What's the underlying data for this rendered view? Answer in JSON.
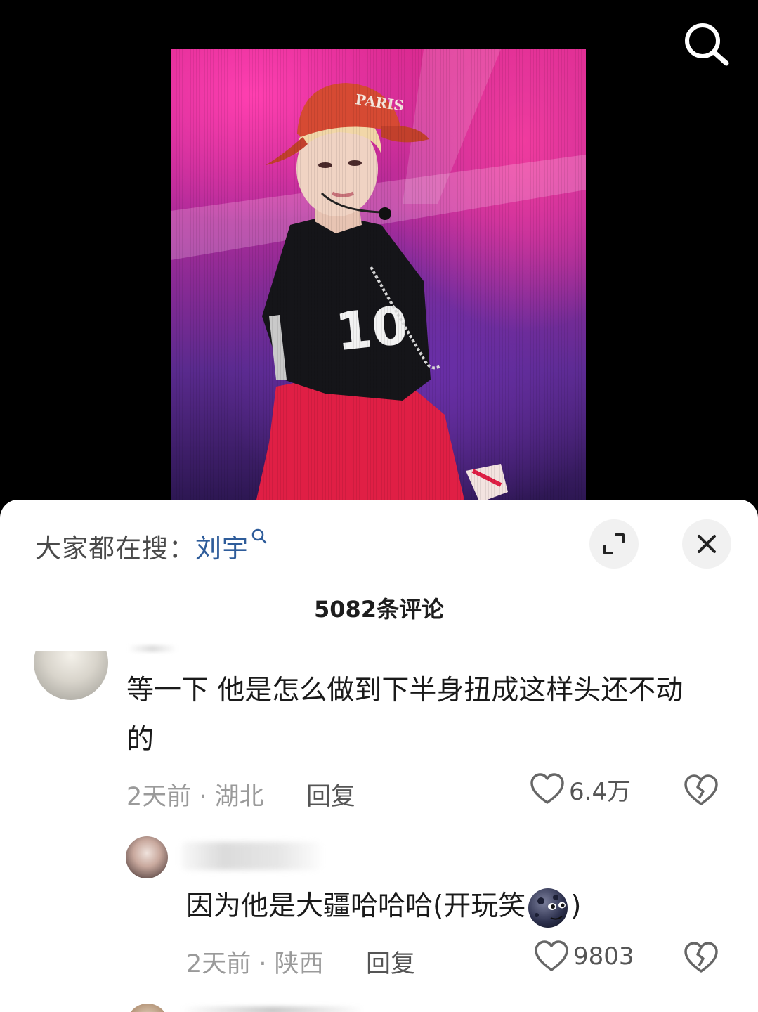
{
  "top_bar": {
    "search_icon": "search-icon"
  },
  "video": {
    "jersey_number": "10"
  },
  "sheet": {
    "trending_prefix": "大家都在搜：",
    "trending_term": "刘宇",
    "expand_icon": "expand-icon",
    "close_icon": "close-icon",
    "comment_count": "5082条评论"
  },
  "comments": [
    {
      "text": "等一下 他是怎么做到下半身扭成这样头还不动的",
      "time_location": "2天前 · 湖北",
      "reply_label": "回复",
      "likes": "6.4万"
    },
    {
      "text_before_emoji": "因为他是大疆哈哈哈(开玩笑",
      "emoji": "new-moon-face-emoji",
      "text_after_emoji": ")",
      "time_location": "2天前 · 陕西",
      "reply_label": "回复",
      "likes": "9803"
    }
  ],
  "colors": {
    "link_blue": "#2e5c9a",
    "meta_gray": "#9a9a9a",
    "sheet_bg": "#ffffff",
    "backdrop": "#000000"
  }
}
